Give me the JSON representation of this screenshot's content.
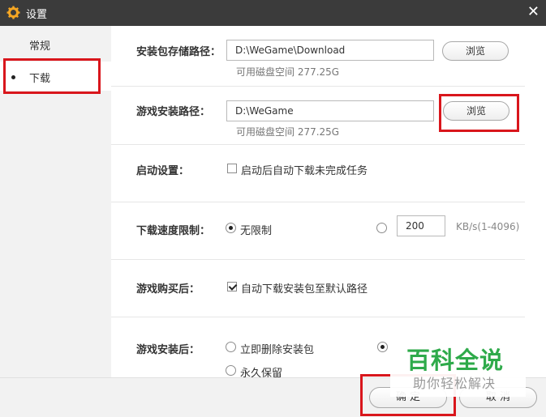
{
  "window": {
    "title": "设置"
  },
  "sidebar": {
    "items": [
      {
        "label": "常规",
        "active": false
      },
      {
        "label": "下载",
        "active": true
      }
    ]
  },
  "settings": {
    "package_path": {
      "label": "安装包存储路径：",
      "value": "D:\\WeGame\\Download",
      "browse": "浏览",
      "free_space": "可用磁盘空间 277.25G"
    },
    "install_path": {
      "label": "游戏安装路径：",
      "value": "D:\\WeGame",
      "browse": "浏览",
      "free_space": "可用磁盘空间 277.25G"
    },
    "startup": {
      "label": "启动设置：",
      "option": "启动后自动下载未完成任务",
      "checked": false
    },
    "speed_limit": {
      "label": "下载速度限制：",
      "unlimited_label": "无限制",
      "unlimited_selected": true,
      "limit_value": "200",
      "unit": "KB/s(1-4096)"
    },
    "after_purchase": {
      "label": "游戏购买后：",
      "option": "自动下载安装包至默认路径",
      "checked": true
    },
    "after_install": {
      "label": "游戏安装后：",
      "option_delete": "立即删除安装包",
      "option_keep": "永久保留"
    }
  },
  "footer": {
    "ok": "确 定",
    "cancel": "取 消"
  },
  "watermark": {
    "title": "百科全说",
    "subtitle": "助你轻松解决"
  },
  "colors": {
    "titlebar": "#3b3b3b",
    "highlight": "#d9161c",
    "watermark_green": "#2eaa4a",
    "gear": "#f5a623"
  }
}
